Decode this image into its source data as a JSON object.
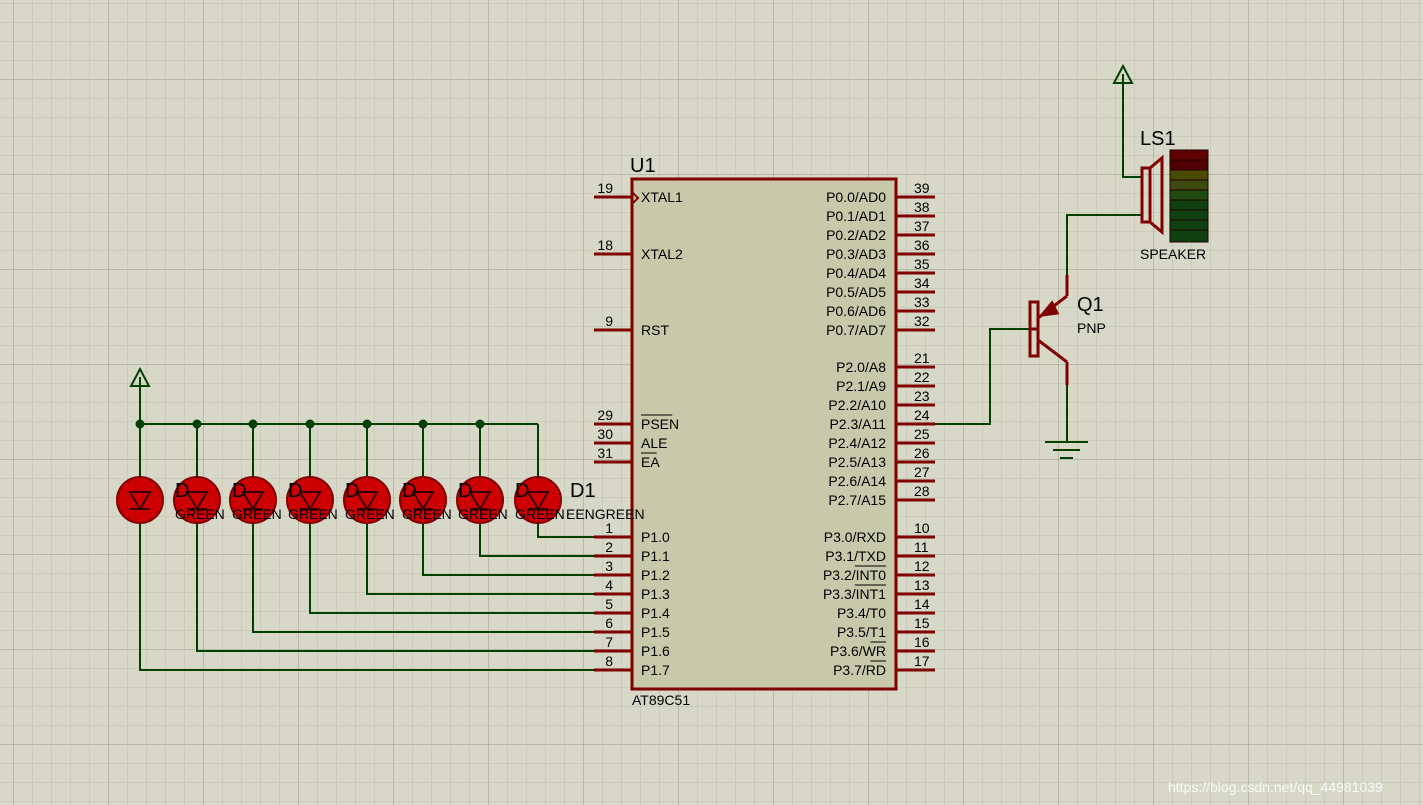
{
  "mcu": {
    "ref": "U1",
    "part": "AT89C51",
    "left_pins": [
      {
        "num": "19",
        "name": "XTAL1"
      },
      {
        "num": "18",
        "name": "XTAL2"
      },
      {
        "num": "9",
        "name": "RST"
      },
      {
        "num": "29",
        "name": "PSEN"
      },
      {
        "num": "30",
        "name": "ALE"
      },
      {
        "num": "31",
        "name": "EA"
      },
      {
        "num": "1",
        "name": "P1.0"
      },
      {
        "num": "2",
        "name": "P1.1"
      },
      {
        "num": "3",
        "name": "P1.2"
      },
      {
        "num": "4",
        "name": "P1.3"
      },
      {
        "num": "5",
        "name": "P1.4"
      },
      {
        "num": "6",
        "name": "P1.5"
      },
      {
        "num": "7",
        "name": "P1.6"
      },
      {
        "num": "8",
        "name": "P1.7"
      }
    ],
    "right_pins": [
      {
        "num": "39",
        "name": "P0.0/AD0"
      },
      {
        "num": "38",
        "name": "P0.1/AD1"
      },
      {
        "num": "37",
        "name": "P0.2/AD2"
      },
      {
        "num": "36",
        "name": "P0.3/AD3"
      },
      {
        "num": "35",
        "name": "P0.4/AD4"
      },
      {
        "num": "34",
        "name": "P0.5/AD5"
      },
      {
        "num": "33",
        "name": "P0.6/AD6"
      },
      {
        "num": "32",
        "name": "P0.7/AD7"
      },
      {
        "num": "21",
        "name": "P2.0/A8"
      },
      {
        "num": "22",
        "name": "P2.1/A9"
      },
      {
        "num": "23",
        "name": "P2.2/A10"
      },
      {
        "num": "24",
        "name": "P2.3/A11"
      },
      {
        "num": "25",
        "name": "P2.4/A12"
      },
      {
        "num": "26",
        "name": "P2.5/A13"
      },
      {
        "num": "27",
        "name": "P2.6/A14"
      },
      {
        "num": "28",
        "name": "P2.7/A15"
      },
      {
        "num": "10",
        "name": "P3.0/RXD"
      },
      {
        "num": "11",
        "name": "P3.1/TXD"
      },
      {
        "num": "12",
        "name": "P3.2/INT0"
      },
      {
        "num": "13",
        "name": "P3.3/INT1"
      },
      {
        "num": "14",
        "name": "P3.4/T0"
      },
      {
        "num": "15",
        "name": "P3.5/T1"
      },
      {
        "num": "16",
        "name": "P3.6/WR"
      },
      {
        "num": "17",
        "name": "P3.7/RD"
      }
    ]
  },
  "leds": {
    "ref": "D1",
    "value": "GREEN",
    "count": 8,
    "overlap_text_left": "D",
    "overlap_text_right": "EENGREEN"
  },
  "transistor": {
    "ref": "Q1",
    "type": "PNP"
  },
  "speaker": {
    "ref": "LS1",
    "value": "SPEAKER"
  },
  "watermark": "https://blog.csdn.net/qq_44981039",
  "colors": {
    "background": "#d8d8c8",
    "component_outline": "#800000",
    "wire": "#004000",
    "chip_fill": "#c8c8aa",
    "led_fill": "#cc0000"
  }
}
